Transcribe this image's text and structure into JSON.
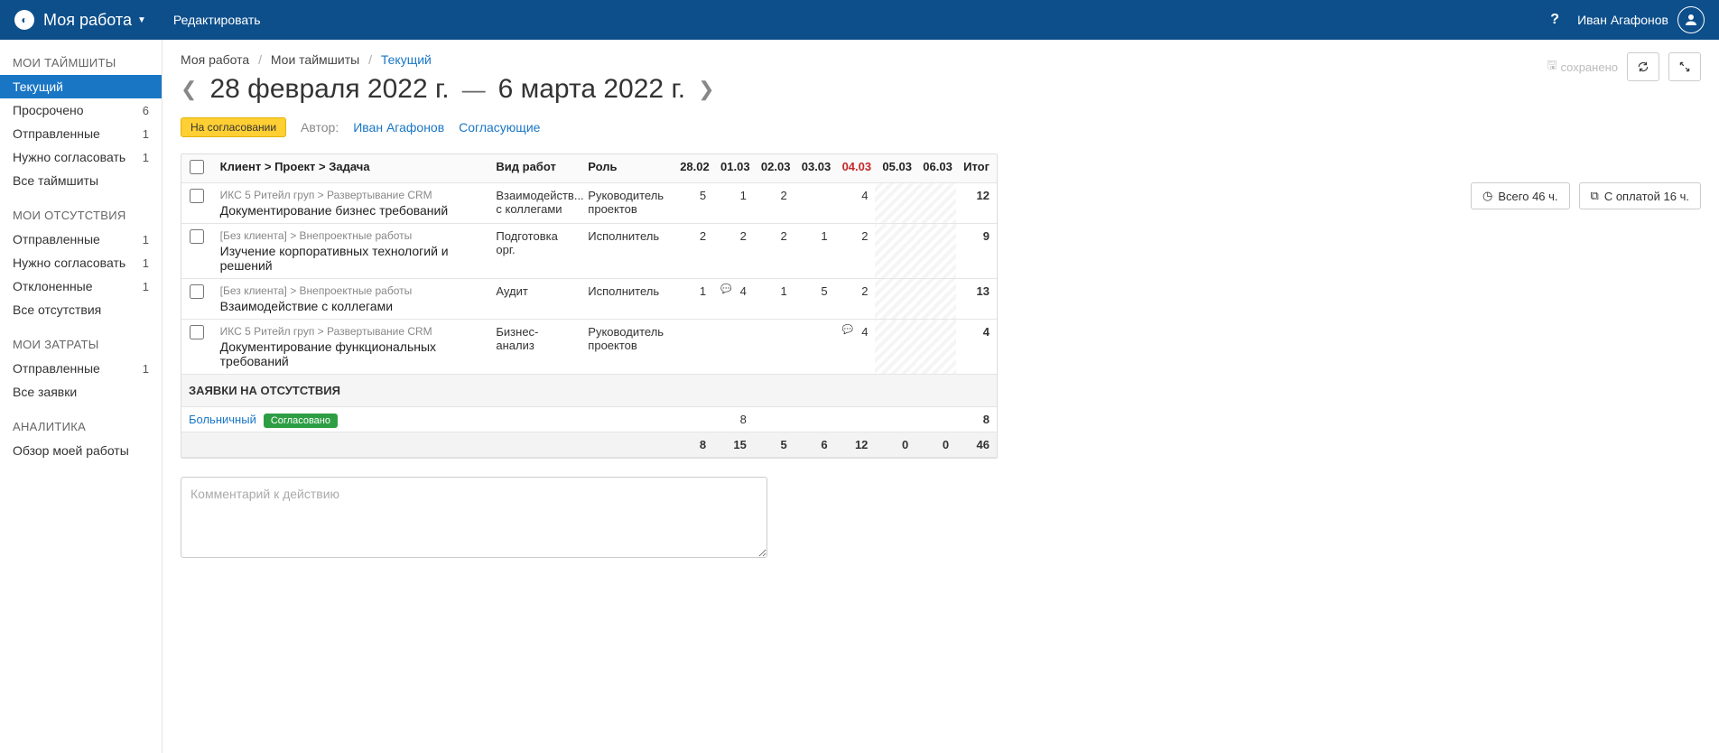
{
  "topbar": {
    "title": "Моя работа",
    "editLink": "Редактировать",
    "userName": "Иван Агафонов"
  },
  "sidebar": {
    "sections": [
      {
        "heading": "МОИ ТАЙМШИТЫ",
        "items": [
          {
            "label": "Текущий",
            "badge": "",
            "active": true
          },
          {
            "label": "Просрочено",
            "badge": "6"
          },
          {
            "label": "Отправленные",
            "badge": "1"
          },
          {
            "label": "Нужно согласовать",
            "badge": "1"
          },
          {
            "label": "Все таймшиты",
            "badge": ""
          }
        ]
      },
      {
        "heading": "МОИ ОТСУТСТВИЯ",
        "items": [
          {
            "label": "Отправленные",
            "badge": "1"
          },
          {
            "label": "Нужно согласовать",
            "badge": "1"
          },
          {
            "label": "Отклоненные",
            "badge": "1"
          },
          {
            "label": "Все отсутствия",
            "badge": ""
          }
        ]
      },
      {
        "heading": "МОИ ЗАТРАТЫ",
        "items": [
          {
            "label": "Отправленные",
            "badge": "1"
          },
          {
            "label": "Все заявки",
            "badge": ""
          }
        ]
      },
      {
        "heading": "АНАЛИТИКА",
        "items": [
          {
            "label": "Обзор моей работы",
            "badge": ""
          }
        ]
      }
    ]
  },
  "breadcrumb": {
    "items": [
      "Моя работа",
      "Мои таймшиты"
    ],
    "current": "Текущий"
  },
  "savedLabel": "сохранено",
  "dateRange": {
    "start": "28 февраля 2022 г.",
    "end": "6 марта 2022 г."
  },
  "meta": {
    "status": "На согласовании",
    "authorLabel": "Автор:",
    "author": "Иван Агафонов",
    "approversLink": "Согласующие"
  },
  "totals": {
    "total": "Всего 46 ч.",
    "paid": "С оплатой 16 ч."
  },
  "table": {
    "headers": {
      "task": "Клиент > Проект > Задача",
      "workType": "Вид работ",
      "role": "Роль",
      "days": [
        "28.02",
        "01.03",
        "02.03",
        "03.03",
        "04.03",
        "05.03",
        "06.03"
      ],
      "total": "Итог"
    },
    "redDayIndex": 4,
    "rows": [
      {
        "path": "ИКС 5 Ритейл груп > Развертывание CRM",
        "name": "Документирование бизнес требований",
        "workType": "Взаимодейств... с коллегами",
        "role": "Руководитель проектов",
        "values": [
          "5",
          "1",
          "2",
          "",
          "4",
          "",
          ""
        ],
        "total": "12",
        "disabled": [
          5,
          6
        ]
      },
      {
        "path": "[Без клиента] > Внепроектные работы",
        "name": "Изучение корпоративных технологий и решений",
        "workType": "Подготовка орг.",
        "role": "Исполнитель",
        "values": [
          "2",
          "2",
          "2",
          "1",
          "2",
          "",
          ""
        ],
        "total": "9",
        "disabled": [
          5,
          6
        ]
      },
      {
        "path": "[Без клиента] > Внепроектные работы",
        "name": "Взаимодействие с коллегами",
        "workType": "Аудит",
        "role": "Исполнитель",
        "values": [
          "1",
          "4",
          "1",
          "5",
          "2",
          "",
          ""
        ],
        "total": "13",
        "disabled": [
          5,
          6
        ],
        "comments": [
          1
        ]
      },
      {
        "path": "ИКС 5 Ритейл груп > Развертывание CRM",
        "name": "Документирование функциональных требований",
        "workType": "Бизнес-анализ",
        "role": "Руководитель проектов",
        "values": [
          "",
          "",
          "",
          "",
          "4",
          "",
          ""
        ],
        "total": "4",
        "disabled": [
          5,
          6
        ],
        "comments": [
          4
        ]
      }
    ],
    "absenceSection": "ЗАЯВКИ НА ОТСУТСТВИЯ",
    "absenceRow": {
      "name": "Больничный",
      "status": "Согласовано",
      "values": [
        "",
        "8",
        "",
        "",
        "",
        "",
        ""
      ],
      "total": "8"
    },
    "footer": [
      "8",
      "15",
      "5",
      "6",
      "12",
      "0",
      "0"
    ],
    "footerTotal": "46"
  },
  "commentPlaceholder": "Комментарий к действию"
}
